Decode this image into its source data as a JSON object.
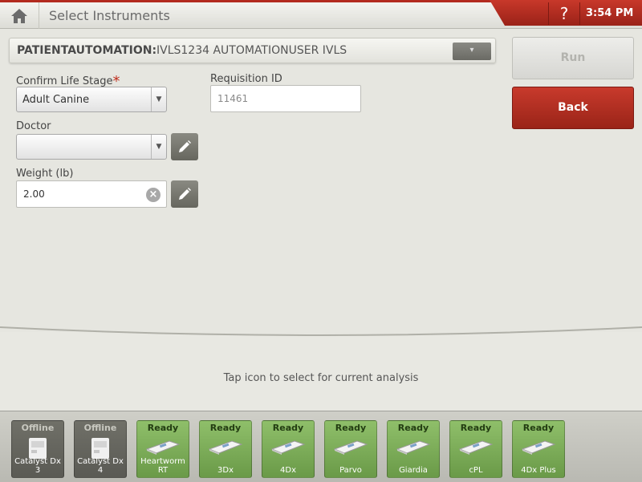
{
  "header": {
    "title": "Select Instruments",
    "help_label": "?",
    "time": "3:54 PM"
  },
  "patient": {
    "label": "PATIENTAUTOMATION:",
    "details": "IVLS1234 AUTOMATIONUSER IVLS"
  },
  "form": {
    "life_stage_label": "Confirm Life Stage",
    "life_stage_value": "Adult Canine",
    "requisition_label": "Requisition ID",
    "requisition_value": "11461",
    "doctor_label": "Doctor",
    "doctor_value": "",
    "weight_label": "Weight (lb)",
    "weight_value": "2.00"
  },
  "actions": {
    "run_label": "Run",
    "back_label": "Back"
  },
  "hint": "Tap icon to select for current analysis",
  "instruments": [
    {
      "status": "Offline",
      "name": "Catalyst Dx 3"
    },
    {
      "status": "Offline",
      "name": "Catalyst Dx 4"
    },
    {
      "status": "Ready",
      "name": "Heartworm RT"
    },
    {
      "status": "Ready",
      "name": "3Dx"
    },
    {
      "status": "Ready",
      "name": "4Dx"
    },
    {
      "status": "Ready",
      "name": "Parvo"
    },
    {
      "status": "Ready",
      "name": "Giardia"
    },
    {
      "status": "Ready",
      "name": "cPL"
    },
    {
      "status": "Ready",
      "name": "4Dx Plus"
    }
  ],
  "colors": {
    "brand_red": "#b32b1f",
    "ready_green": "#7aab55",
    "offline_gray": "#65655e"
  }
}
